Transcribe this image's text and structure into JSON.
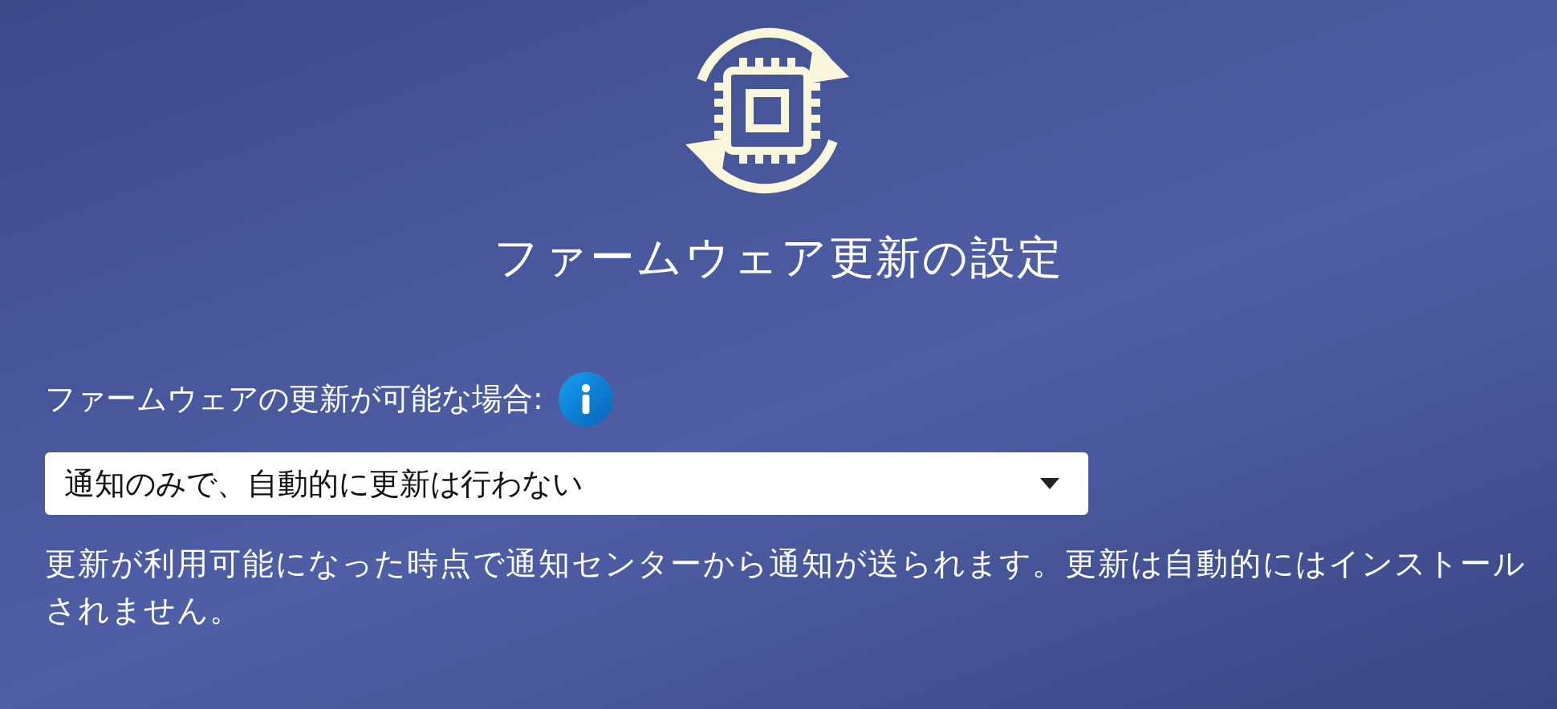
{
  "title": "ファームウェア更新の設定",
  "setting": {
    "label": "ファームウェアの更新が可能な場合:",
    "value": "通知のみで、自動的に更新は行わない",
    "description": "更新が利用可能になった時点で通知センターから通知が送られます。更新は自動的にはインストールされません。"
  }
}
